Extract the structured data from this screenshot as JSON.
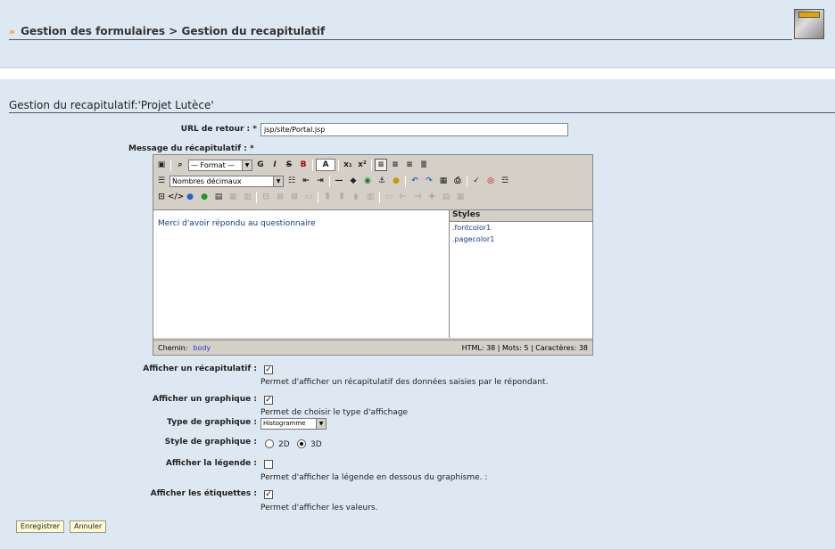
{
  "breadcrumb": {
    "item1": "Gestion des formulaires",
    "item2": "> Gestion du recapitulatif"
  },
  "section": {
    "title": "Gestion du recapitulatif:'Projet Lutèce'"
  },
  "url_retour": {
    "label": "URL de retour : *",
    "value": "jsp/site/Portal.jsp"
  },
  "message": {
    "label": "Message du récapitulatif : *",
    "content": "Merci d'avoir répondu au questionnaire"
  },
  "editor": {
    "format_select": "— Format —",
    "list_select": "Nombres décimaux",
    "styles_header": "Styles",
    "styles": [
      ".fontcolor1",
      ".pagecolor1"
    ],
    "path_label": "Chemin:",
    "path_value": "body",
    "stats": "HTML: 38 | Mots: 5 | Caractères: 38"
  },
  "options": {
    "afficher_recap_label": "Afficher un récapitulatif :",
    "afficher_recap_help": "Permet d'afficher un récapitulatif des données saisies par le répondant.",
    "afficher_graph_label": "Afficher un graphique :",
    "afficher_graph_help": "Permet de choisir le type d'affichage",
    "type_graph_label": "Type de graphique :",
    "type_graph_value": "Histogramme",
    "style_graph_label": "Style de graphique :",
    "style_2d": "2D",
    "style_3d": "3D",
    "legende_label": "Afficher la légende :",
    "legende_help": "Permet d'afficher la légende en dessous du graphisme. :",
    "etiquettes_label": "Afficher les étiquettes :",
    "etiquettes_help": "Permet d'afficher les valeurs."
  },
  "buttons": {
    "save": "Enregistrer",
    "cancel": "Annuler"
  }
}
